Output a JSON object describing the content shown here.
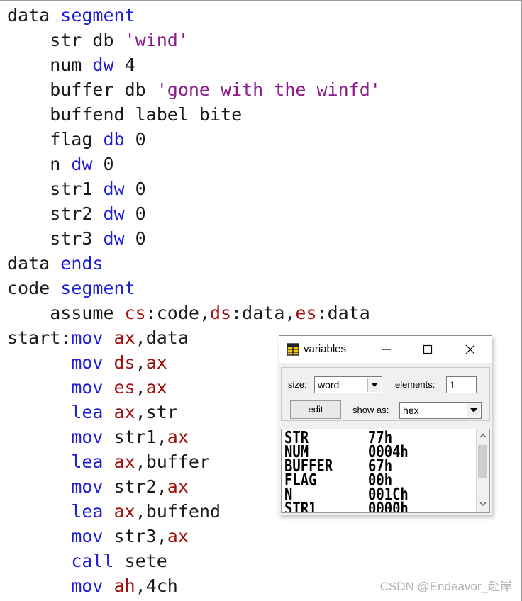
{
  "editor": {
    "lines": [
      [
        [
          "kw-plain",
          "data "
        ],
        [
          "kw",
          "segment"
        ]
      ],
      [
        [
          "plain",
          "    str db "
        ],
        [
          "str",
          "'wind'"
        ]
      ],
      [
        [
          "plain",
          "    num "
        ],
        [
          "kw",
          "dw"
        ],
        [
          "plain",
          " 4"
        ]
      ],
      [
        [
          "plain",
          "    buffer db "
        ],
        [
          "str",
          "'gone with the winfd'"
        ]
      ],
      [
        [
          "plain",
          "    buffend label bite"
        ]
      ],
      [
        [
          "plain",
          "    flag "
        ],
        [
          "kw",
          "db"
        ],
        [
          "plain",
          " 0"
        ]
      ],
      [
        [
          "plain",
          "    n "
        ],
        [
          "kw",
          "dw"
        ],
        [
          "plain",
          " 0"
        ]
      ],
      [
        [
          "plain",
          "    str1 "
        ],
        [
          "kw",
          "dw"
        ],
        [
          "plain",
          " 0"
        ]
      ],
      [
        [
          "plain",
          "    str2 "
        ],
        [
          "kw",
          "dw"
        ],
        [
          "plain",
          " 0"
        ]
      ],
      [
        [
          "plain",
          "    str3 "
        ],
        [
          "kw",
          "dw"
        ],
        [
          "plain",
          " 0"
        ]
      ],
      [
        [
          "plain",
          "data "
        ],
        [
          "kw",
          "ends"
        ]
      ],
      [
        [
          "plain",
          "code "
        ],
        [
          "kw",
          "segment"
        ]
      ],
      [
        [
          "plain",
          "    assume "
        ],
        [
          "reg",
          "cs"
        ],
        [
          "plain",
          ":code,"
        ],
        [
          "reg",
          "ds"
        ],
        [
          "plain",
          ":data,"
        ],
        [
          "reg",
          "es"
        ],
        [
          "plain",
          ":data"
        ]
      ],
      [
        [
          "plain",
          "start:"
        ],
        [
          "kw",
          "mov"
        ],
        [
          "plain",
          " "
        ],
        [
          "reg",
          "ax"
        ],
        [
          "plain",
          ",data"
        ]
      ],
      [
        [
          "plain",
          "      "
        ],
        [
          "kw",
          "mov"
        ],
        [
          "plain",
          " "
        ],
        [
          "reg",
          "ds"
        ],
        [
          "plain",
          ","
        ],
        [
          "reg",
          "ax"
        ]
      ],
      [
        [
          "plain",
          "      "
        ],
        [
          "kw",
          "mov"
        ],
        [
          "plain",
          " "
        ],
        [
          "reg",
          "es"
        ],
        [
          "plain",
          ","
        ],
        [
          "reg",
          "ax"
        ]
      ],
      [
        [
          "plain",
          "      "
        ],
        [
          "kw",
          "lea"
        ],
        [
          "plain",
          " "
        ],
        [
          "reg",
          "ax"
        ],
        [
          "plain",
          ",str"
        ]
      ],
      [
        [
          "plain",
          "      "
        ],
        [
          "kw",
          "mov"
        ],
        [
          "plain",
          " str1,"
        ],
        [
          "reg",
          "ax"
        ]
      ],
      [
        [
          "plain",
          "      "
        ],
        [
          "kw",
          "lea"
        ],
        [
          "plain",
          " "
        ],
        [
          "reg",
          "ax"
        ],
        [
          "plain",
          ",buffer"
        ]
      ],
      [
        [
          "plain",
          "      "
        ],
        [
          "kw",
          "mov"
        ],
        [
          "plain",
          " str2,"
        ],
        [
          "reg",
          "ax"
        ]
      ],
      [
        [
          "plain",
          "      "
        ],
        [
          "kw",
          "lea"
        ],
        [
          "plain",
          " "
        ],
        [
          "reg",
          "ax"
        ],
        [
          "plain",
          ",buffend"
        ]
      ],
      [
        [
          "plain",
          "      "
        ],
        [
          "kw",
          "mov"
        ],
        [
          "plain",
          " str3,"
        ],
        [
          "reg",
          "ax"
        ]
      ],
      [
        [
          "plain",
          "      "
        ],
        [
          "kw",
          "call"
        ],
        [
          "plain",
          " sete"
        ]
      ],
      [
        [
          "plain",
          "      "
        ],
        [
          "kw",
          "mov"
        ],
        [
          "plain",
          " "
        ],
        [
          "reg",
          "ah"
        ],
        [
          "plain",
          ",4ch"
        ]
      ]
    ]
  },
  "watermark": "CSDN @Endeavor_赴岸",
  "variables_window": {
    "title": "variables",
    "icon": "table-icon",
    "size_label": "size:",
    "size_value": "word",
    "elements_label": "elements:",
    "elements_value": "1",
    "edit_label": "edit",
    "show_as_label": "show as:",
    "show_as_value": "hex",
    "rows": [
      {
        "name": "STR",
        "value": "77h"
      },
      {
        "name": "NUM",
        "value": "0004h"
      },
      {
        "name": "BUFFER",
        "value": "67h"
      },
      {
        "name": "FLAG",
        "value": "00h"
      },
      {
        "name": "N",
        "value": "001Ch"
      },
      {
        "name": "STR1",
        "value": "0000h"
      }
    ]
  },
  "colors": {
    "keyword": "#1f1fd6",
    "string": "#8b1c8b",
    "register": "#a01010",
    "text": "#1a1a1a"
  }
}
